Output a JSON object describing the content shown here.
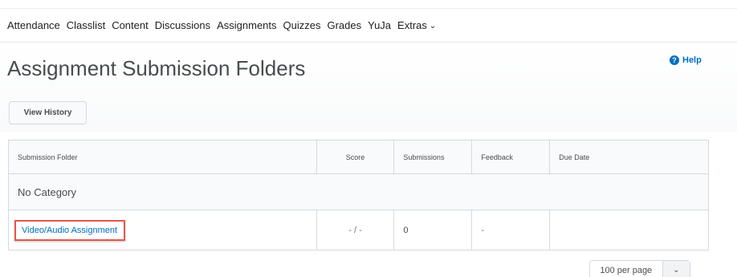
{
  "nav": {
    "items": [
      {
        "label": "Attendance"
      },
      {
        "label": "Classlist"
      },
      {
        "label": "Content"
      },
      {
        "label": "Discussions"
      },
      {
        "label": "Assignments"
      },
      {
        "label": "Quizzes"
      },
      {
        "label": "Grades"
      },
      {
        "label": "YuJa"
      },
      {
        "label": "Extras"
      }
    ],
    "extras_icon": "chevron-down-icon"
  },
  "page": {
    "title": "Assignment Submission Folders",
    "help_label": "Help",
    "help_icon": "question-circle-icon",
    "view_history_label": "View History"
  },
  "table": {
    "columns": [
      "Submission Folder",
      "Score",
      "Submissions",
      "Feedback",
      "Due Date"
    ],
    "category": "No Category",
    "rows": [
      {
        "folder": "Video/Audio Assignment",
        "score": "- / -",
        "submissions": "0",
        "feedback": "-",
        "due_date": ""
      }
    ]
  },
  "pager": {
    "selected": "100 per page",
    "icon": "chevron-down-icon"
  },
  "colors": {
    "link": "#006fbf",
    "highlight": "#e3574d",
    "text": "#494c4e"
  }
}
